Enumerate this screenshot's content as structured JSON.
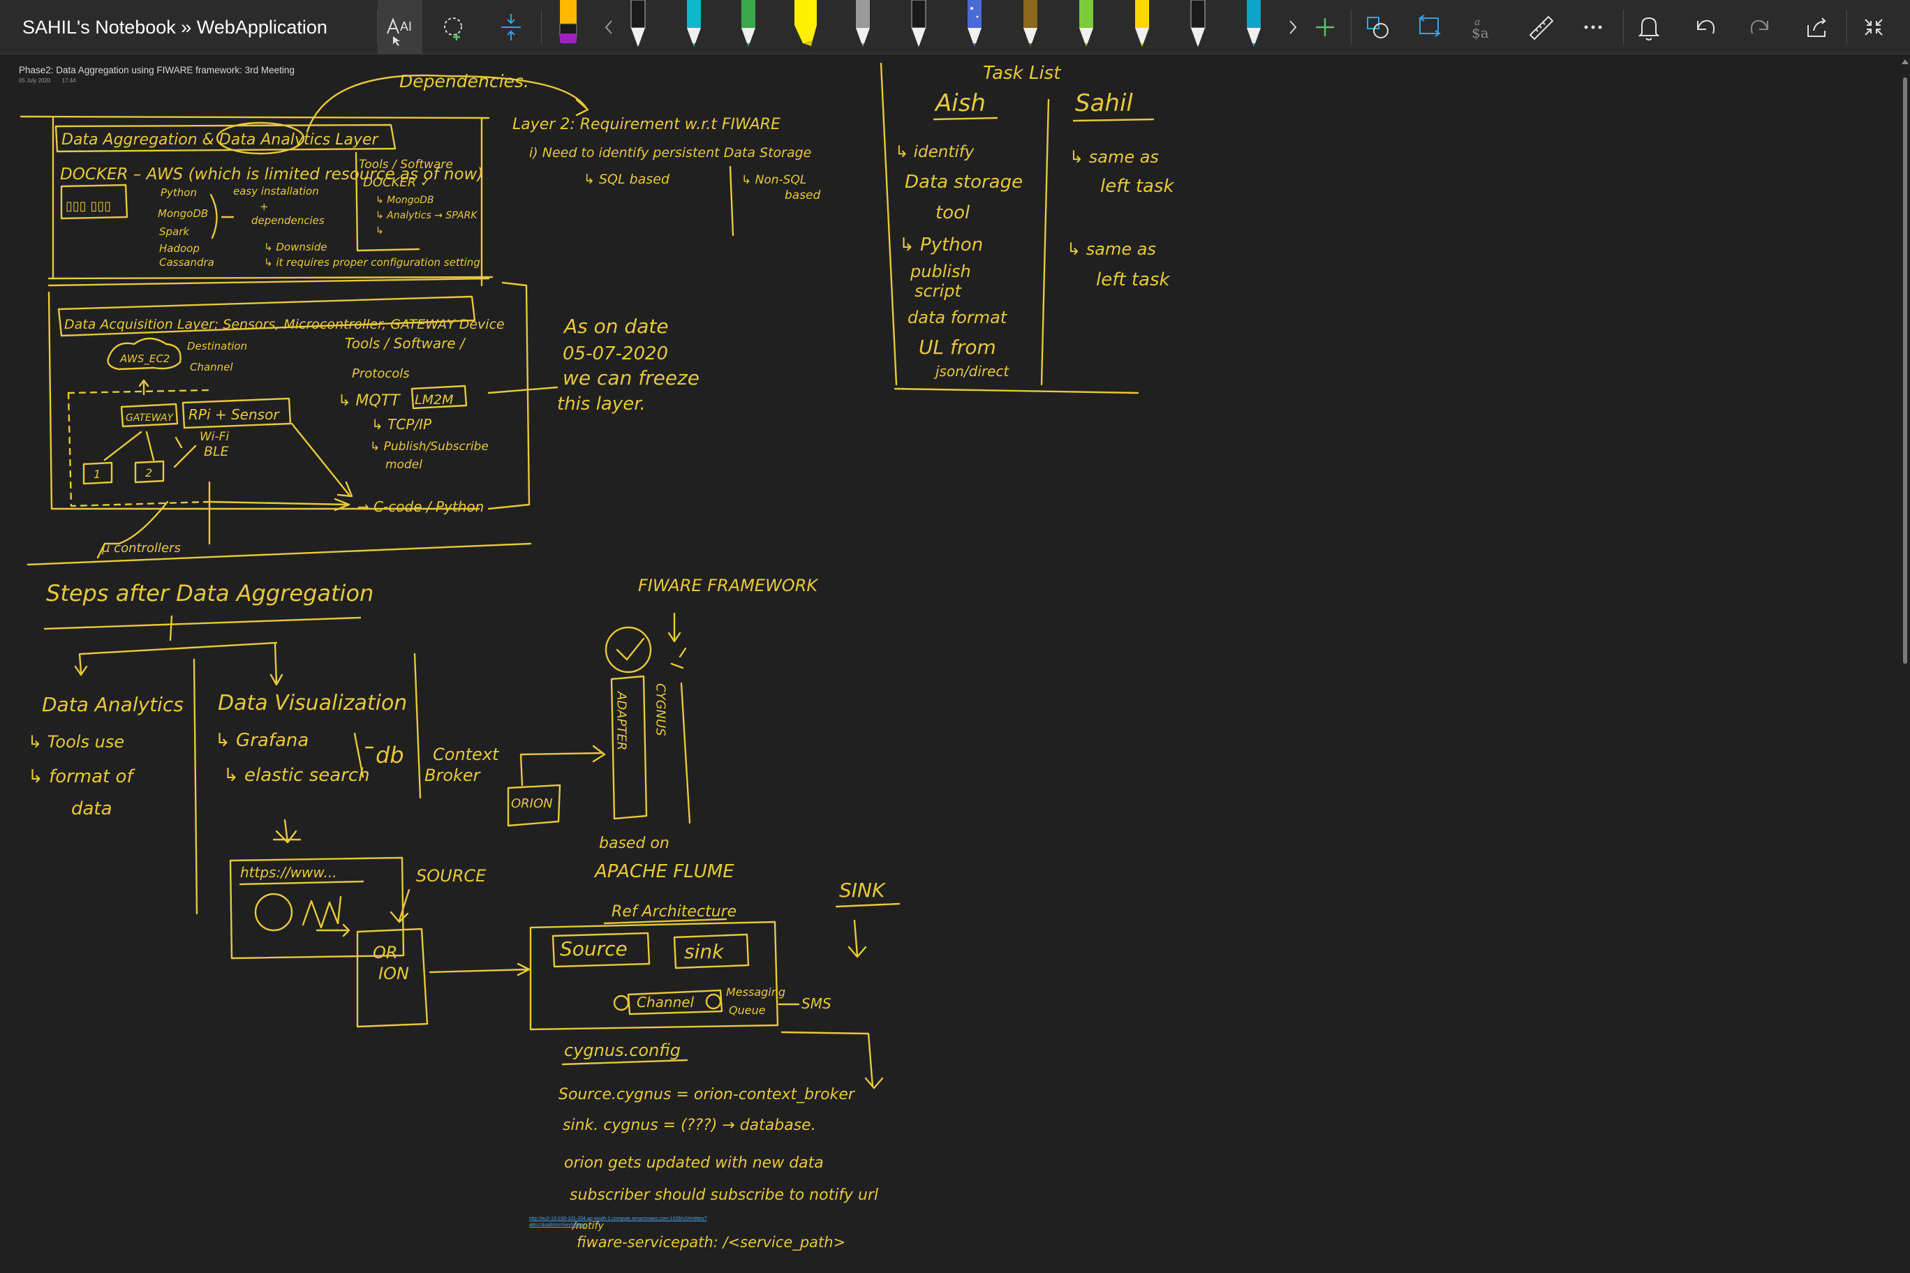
{
  "window": {
    "title": "SAHIL's Notebook » WebApplication"
  },
  "toolbar": {
    "tools": [
      {
        "name": "ink-to-text-icon",
        "active": true
      },
      {
        "name": "lasso-select-icon"
      },
      {
        "name": "add-space-icon"
      }
    ],
    "pens": [
      {
        "name": "pen-black-purple",
        "color": "#1a1a1a",
        "tip": "#ffb900",
        "cap": "#a020c0"
      },
      {
        "name": "pen-white",
        "color": "#ffffff"
      },
      {
        "name": "pen-teal",
        "color": "#0fb5c8"
      },
      {
        "name": "pen-green",
        "color": "#3aa84a"
      },
      {
        "name": "highlighter-yellow",
        "color": "#fff100"
      },
      {
        "name": "pen-gray",
        "color": "#9a9a9a"
      },
      {
        "name": "pen-white-2",
        "color": "#ffffff"
      },
      {
        "name": "pen-galaxy",
        "color": "#4a6ad8"
      },
      {
        "name": "pen-brown",
        "color": "#8a6a1a"
      },
      {
        "name": "pen-lime",
        "color": "#7ccc3a"
      },
      {
        "name": "pen-yellow",
        "color": "#ffd700"
      },
      {
        "name": "pen-white-3",
        "color": "#ffffff"
      },
      {
        "name": "pen-cyan",
        "color": "#0fa5c8"
      }
    ],
    "right_icons": [
      "shapes-icon",
      "ink-to-shape-icon",
      "ink-to-math-icon",
      "ruler-icon",
      "more-icon",
      "notifications-icon",
      "undo-icon",
      "redo-icon",
      "share-icon",
      "collapse-icon"
    ]
  },
  "page": {
    "title": "Phase2: Data Aggregation using FIWARE framework: 3rd Meeting",
    "date": "05 July 2020",
    "time": "17:44"
  },
  "ink": {
    "dependencies": "Dependencies.",
    "layer_title": "Data Aggregation & Data Analytics Layer",
    "docker_line": "DOCKER – AWS (which is limited resource as of now)",
    "docker_list": [
      "Python",
      "MongoDB",
      "Spark",
      "Hadoop",
      "Cassandra"
    ],
    "docker_install": [
      "easy installation",
      "+",
      "dependencies"
    ],
    "docker_down": [
      "↳ Downside",
      "↳ it requires proper configuration setting"
    ],
    "tools_software": [
      "Tools / Software",
      "DOCKER ✓",
      "↳ MongoDB",
      "↳ Analytics → SPARK",
      "↳"
    ],
    "layer2": [
      "Layer 2: Requirement w.r.t FIWARE",
      "i) Need to identify persistent Data Storage",
      "↳ SQL based",
      "↳ Non-SQL",
      "based"
    ],
    "task_list": "Task List",
    "aish": "Aish",
    "sahil": "Sahil",
    "aish_tasks": [
      "↳ identify",
      "Data storage",
      "tool",
      "↳ Python",
      "publish",
      "script",
      "data format",
      "UL from",
      "json/direct"
    ],
    "sahil_tasks": [
      "↳ same as",
      "left task",
      "↳ same as",
      "left task"
    ],
    "acquisition_title": "Data Acquisition Layer: Sensors, Microcontroller, GATEWAY Device",
    "aws_ec2": "AWS_EC2",
    "destination": "Destination",
    "channel": "Channel",
    "gateway": "GATEWAY",
    "rpi": "RPi + Sensor",
    "wifi": "Wi-Fi",
    "ble": "BLE",
    "node1": "1",
    "node2": "2",
    "microcontrollers": "μ controllers",
    "protocols": [
      "Tools / Software /",
      "Protocols",
      "↳ MQTT",
      "LM2M",
      "↳ TCP/IP",
      "↳ Publish/Subscribe",
      "model"
    ],
    "c_code": "→ C-code / Python",
    "as_on_date": [
      "As on date",
      "05-07-2020",
      "we can freeze",
      "this layer."
    ],
    "steps": "Steps after Data Aggregation",
    "analytics": [
      "Data Analytics",
      "↳ Tools use",
      "↳ format of",
      "data"
    ],
    "visualization": [
      "Data Visualization",
      "↳ Grafana",
      "↳ elastic search",
      "db"
    ],
    "context_broker": [
      "Context",
      "Broker"
    ],
    "orion": "ORION",
    "fiware_framework": "FIWARE FRAMEWORK",
    "adapter": "ADAPTER",
    "cygnus": "CYGNUS",
    "based_on": "based on",
    "apache_flume": "APACHE FLUME",
    "ref_architecture": "Ref Architecture",
    "https": "https://www...",
    "source_label": "SOURCE",
    "sink_label": "SINK",
    "orion_box": [
      "OR",
      "ION"
    ],
    "flume_source": "Source",
    "flume_sink": "sink",
    "flume_channel": "Channel",
    "messaging_queue": [
      "Messaging",
      "Queue"
    ],
    "sms": "SMS",
    "cygnus_config": "cygnus.config",
    "config_lines": [
      "Source.cygnus = orion-context_broker",
      "sink. cygnus = (???) → database.",
      "orion gets updated with new data",
      "subscriber should subscribe to notify url"
    ],
    "link": "http://ec2-13-233-101-204.ap-south-1.compute.amazonaws.com:1026/v2/entities?attrs=&options=keyValues",
    "notify": "/notify",
    "fiware_servicepath": "fiware-servicepath: /<service_path>"
  }
}
